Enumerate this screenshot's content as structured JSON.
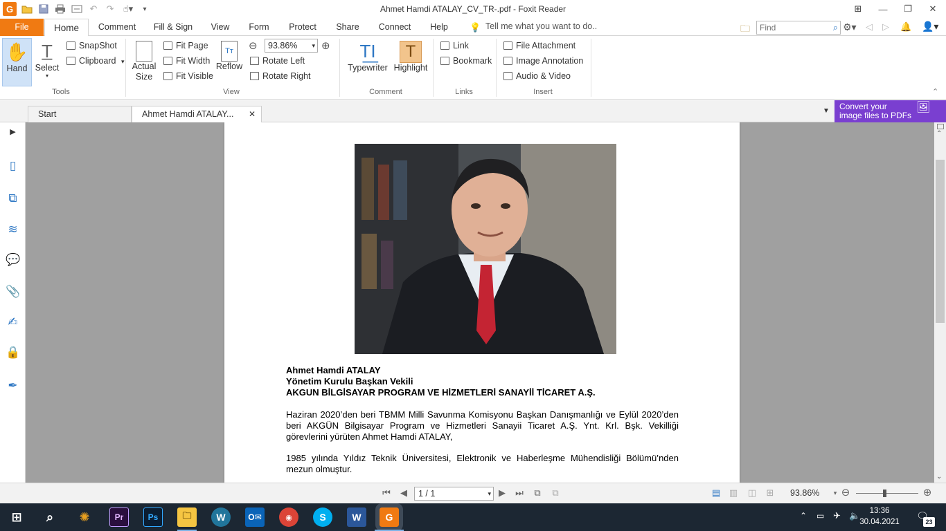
{
  "window": {
    "title": "Ahmet Hamdi ATALAY_CV_TR-.pdf - Foxit Reader",
    "app_icon": "G"
  },
  "menu": {
    "tabs": [
      "File",
      "Home",
      "Comment",
      "Fill & Sign",
      "View",
      "Form",
      "Protect",
      "Share",
      "Connect",
      "Help"
    ],
    "tell_me": "Tell me what you want to do..",
    "find_placeholder": "Find"
  },
  "ribbon": {
    "hand": "Hand",
    "select": "Select",
    "snapshot": "SnapShot",
    "clipboard": "Clipboard",
    "actual_size_1": "Actual",
    "actual_size_2": "Size",
    "fit_page": "Fit Page",
    "fit_width": "Fit Width",
    "fit_visible": "Fit Visible",
    "reflow": "Reflow",
    "zoom_value": "93.86%",
    "rotate_left": "Rotate Left",
    "rotate_right": "Rotate Right",
    "typewriter": "Typewriter",
    "highlight": "Highlight",
    "link": "Link",
    "bookmark": "Bookmark",
    "file_attachment": "File Attachment",
    "image_annotation": "Image Annotation",
    "audio_video": "Audio & Video",
    "groups": {
      "tools": "Tools",
      "view": "View",
      "comment": "Comment",
      "links": "Links",
      "insert": "Insert"
    }
  },
  "doc_tabs": {
    "start": "Start",
    "active": "Ahmet Hamdi ATALAY..."
  },
  "promo": {
    "line1": "Convert your",
    "line2": "image files to PDFs"
  },
  "document": {
    "name": "Ahmet Hamdi ATALAY",
    "position": "Yönetim Kurulu Başkan Vekili",
    "company": "AKGUN BİLGİSAYAR PROGRAM VE HİZMETLERİ SANAYİİ TİCARET A.Ş.",
    "para1": "Haziran 2020’den beri  TBMM Milli Savunma Komisyonu Başkan Danışmanlığı ve Eylül 2020’den beri AKGÜN Bilgisayar Program ve Hizmetleri Sanayii Ticaret A.Ş. Ynt. Krl. Bşk. Vekilliği görevlerini yürüten Ahmet Hamdi ATALAY,",
    "para2": "1985 yılında Yıldız Teknik Üniversitesi, Elektronik ve Haberleşme Mühendisliği Bölümü’nden mezun olmuştur."
  },
  "status": {
    "page_indicator": "1 / 1",
    "zoom": "93.86%"
  },
  "taskbar": {
    "time": "13:36",
    "date": "30.04.2021",
    "notifications": "23",
    "apps": [
      "Premiere",
      "Photoshop",
      "Explorer",
      "WordPress",
      "Outlook",
      "Chrome",
      "Skype",
      "Word",
      "Foxit"
    ]
  },
  "colors": {
    "accent_orange": "#f07a12",
    "promo_purple": "#7a3fd0",
    "taskbar": "#1c2733"
  }
}
